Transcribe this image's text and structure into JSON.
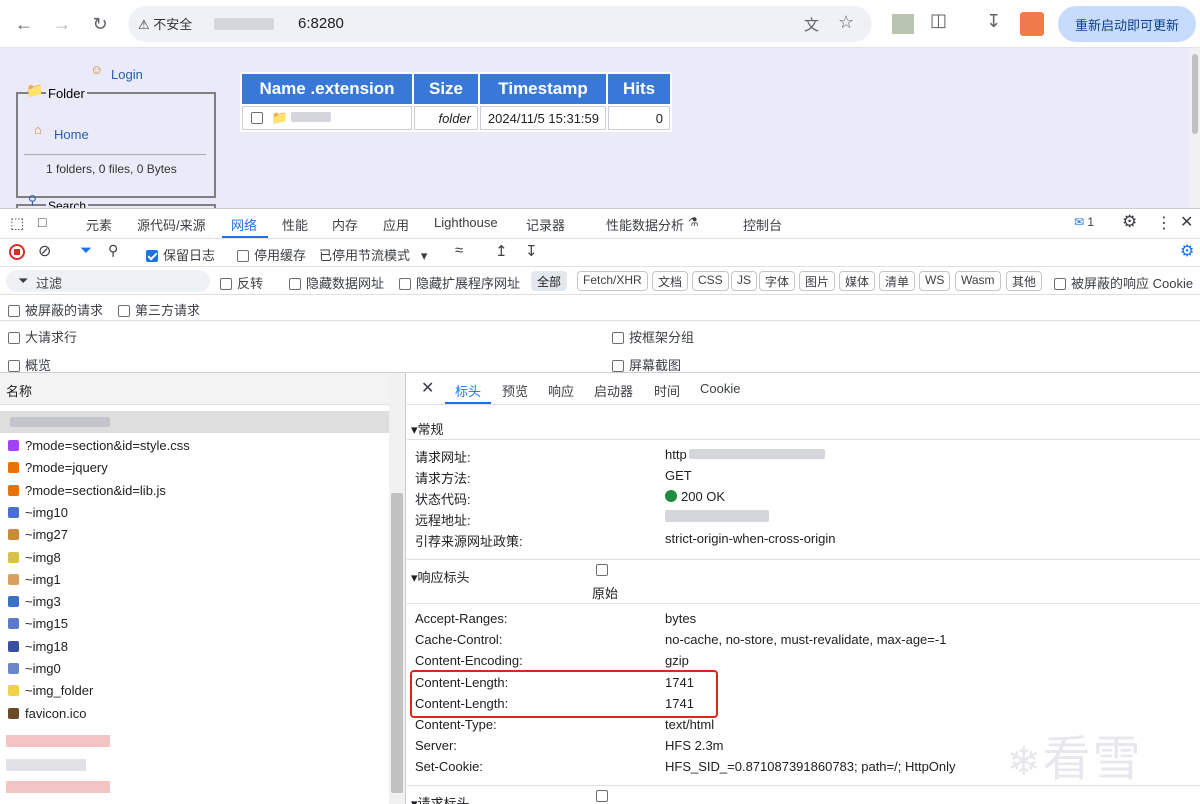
{
  "browser": {
    "security_label": "不安全",
    "url_port": "6:8280",
    "update_button": "重新启动即可更新"
  },
  "page": {
    "login_label": "Login",
    "folder_legend": "Folder",
    "home_label": "Home",
    "folder_stats": "1 folders, 0 files, 0 Bytes",
    "search_legend": "Search",
    "table_headers": [
      "Name .extension",
      "Size",
      "Timestamp",
      "Hits"
    ],
    "row": {
      "size": "folder",
      "timestamp": "2024/11/5 15:31:59",
      "hits": "0"
    }
  },
  "devtools": {
    "tabs": [
      "元素",
      "源代码/来源",
      "网络",
      "性能",
      "内存",
      "应用",
      "Lighthouse",
      "记录器",
      "性能数据分析",
      "控制台"
    ],
    "active_tab": "网络",
    "issues_count": "1",
    "toolbar": {
      "preserve_log": "保留日志",
      "disable_cache": "停用缓存",
      "throttle": "已停用节流模式"
    },
    "filter": {
      "placeholder": "过滤",
      "invert": "反转",
      "hide_data_urls": "隐藏数据网址",
      "hide_ext_urls": "隐藏扩展程序网址",
      "types": [
        "全部",
        "Fetch/XHR",
        "文档",
        "CSS",
        "JS",
        "字体",
        "图片",
        "媒体",
        "清单",
        "WS",
        "Wasm",
        "其他"
      ],
      "blocked_cookies": "被屏蔽的响应 Cookie",
      "blocked_requests": "被屏蔽的请求",
      "third_party": "第三方请求"
    },
    "options": {
      "large_rows": "大请求行",
      "group_by_frame": "按框架分组",
      "overview": "概览",
      "screenshots": "屏幕截图"
    },
    "name_column": "名称",
    "requests": [
      {
        "name": "?mode=section&id=style.css",
        "color": "#a142f4"
      },
      {
        "name": "?mode=jquery",
        "color": "#e8710a"
      },
      {
        "name": "?mode=section&id=lib.js",
        "color": "#e8710a"
      },
      {
        "name": "~img10",
        "color": "#4a6fd0"
      },
      {
        "name": "~img27",
        "color": "#c98a3a"
      },
      {
        "name": "~img8",
        "color": "#d6c24b"
      },
      {
        "name": "~img1",
        "color": "#d9a05b"
      },
      {
        "name": "~img3",
        "color": "#3b72c8"
      },
      {
        "name": "~img15",
        "color": "#5a79c8"
      },
      {
        "name": "~img18",
        "color": "#3a4fa0"
      },
      {
        "name": "~img0",
        "color": "#6a88c8"
      },
      {
        "name": "~img_folder",
        "color": "#f2d24b"
      },
      {
        "name": "favicon.ico",
        "color": "#6b4a2a"
      }
    ],
    "detail_tabs": [
      "标头",
      "预览",
      "响应",
      "启动器",
      "时间",
      "Cookie"
    ],
    "general": {
      "title": "常规",
      "rows": [
        {
          "key": "请求网址:",
          "value": "http"
        },
        {
          "key": "请求方法:",
          "value": "GET"
        },
        {
          "key": "状态代码:",
          "value": "200 OK"
        },
        {
          "key": "远程地址:",
          "value": ""
        },
        {
          "key": "引荐来源网址政策:",
          "value": "strict-origin-when-cross-origin"
        }
      ]
    },
    "response_headers": {
      "title": "响应标头",
      "raw_label": "原始",
      "rows": [
        {
          "key": "Accept-Ranges:",
          "value": "bytes"
        },
        {
          "key": "Cache-Control:",
          "value": "no-cache, no-store, must-revalidate, max-age=-1"
        },
        {
          "key": "Content-Encoding:",
          "value": "gzip"
        },
        {
          "key": "Content-Length:",
          "value": "1741"
        },
        {
          "key": "Content-Length:",
          "value": "1741"
        },
        {
          "key": "Content-Type:",
          "value": "text/html"
        },
        {
          "key": "Server:",
          "value": "HFS 2.3m"
        },
        {
          "key": "Set-Cookie:",
          "value": "HFS_SID_=0.871087391860783; path=/; HttpOnly"
        }
      ]
    },
    "request_headers_title": "请求标头",
    "highlight_color": "#e0231b",
    "watermark": "看雪"
  }
}
